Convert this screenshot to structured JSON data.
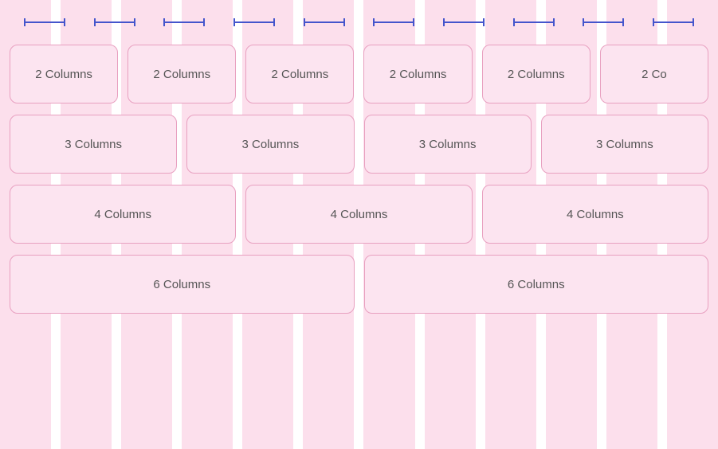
{
  "colors": {
    "stripe": "#f9b8d4",
    "block_bg": "#fce4f0",
    "block_border": "#e8a0c0",
    "ruler": "#4455cc",
    "text": "#555555"
  },
  "rulers": {
    "count": 10,
    "label": "column marker"
  },
  "rows": [
    {
      "id": "row-2col",
      "blocks": [
        {
          "label": "2 Columns",
          "span": 2
        },
        {
          "label": "2 Columns",
          "span": 2
        },
        {
          "label": "2 Columns",
          "span": 2
        },
        {
          "label": "2 Columns",
          "span": 2
        },
        {
          "label": "2 Columns",
          "span": 2
        },
        {
          "label": "2 Co",
          "span": 2
        }
      ]
    },
    {
      "id": "row-3col",
      "blocks": [
        {
          "label": "3 Columns",
          "span": 3
        },
        {
          "label": "3 Columns",
          "span": 3
        },
        {
          "label": "3 Columns",
          "span": 3
        },
        {
          "label": "3 Columns",
          "span": 3
        }
      ]
    },
    {
      "id": "row-4col",
      "blocks": [
        {
          "label": "4 Columns",
          "span": 4
        },
        {
          "label": "4 Columns",
          "span": 4
        },
        {
          "label": "4 Columns",
          "span": 4
        }
      ]
    },
    {
      "id": "row-6col",
      "blocks": [
        {
          "label": "6 Columns",
          "span": 6
        },
        {
          "label": "6 Columns",
          "span": 6
        }
      ]
    }
  ]
}
